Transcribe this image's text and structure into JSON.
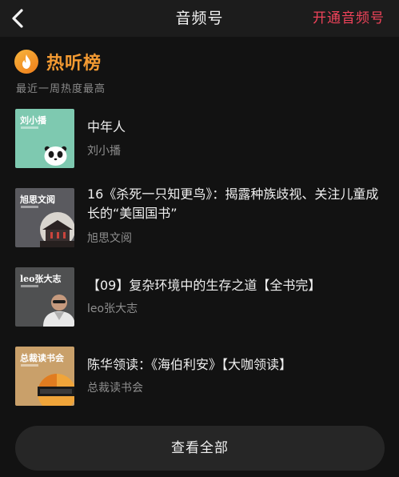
{
  "header": {
    "title": "音频号",
    "open_label": "开通音频号"
  },
  "section": {
    "title": "热听榜",
    "subtitle": "最近一周热度最高"
  },
  "items": [
    {
      "title": "中年人",
      "author": "刘小播",
      "cover_label": "刘小播",
      "cover_color": "#7ec9b0"
    },
    {
      "title": "16《杀死一只知更鸟》：揭露种族歧视、关注儿童成长的“美国国书”",
      "author": "旭思文阅",
      "cover_label": "旭思文阅",
      "cover_color": "#5a5a5f"
    },
    {
      "title": "【09】复杂环境中的生存之道【全书完】",
      "author": "leo张大志",
      "cover_label": "leo张大志",
      "cover_color": "#4f5051"
    },
    {
      "title": "陈华领读：《海伯利安》【大咖领读】",
      "author": "总裁读书会",
      "cover_label": "总裁读书会",
      "cover_color": "#c9a06a"
    }
  ],
  "footer": {
    "view_all_label": "查看全部"
  },
  "colors": {
    "accent_red": "#f0435a",
    "accent_orange": "#f39a32"
  }
}
